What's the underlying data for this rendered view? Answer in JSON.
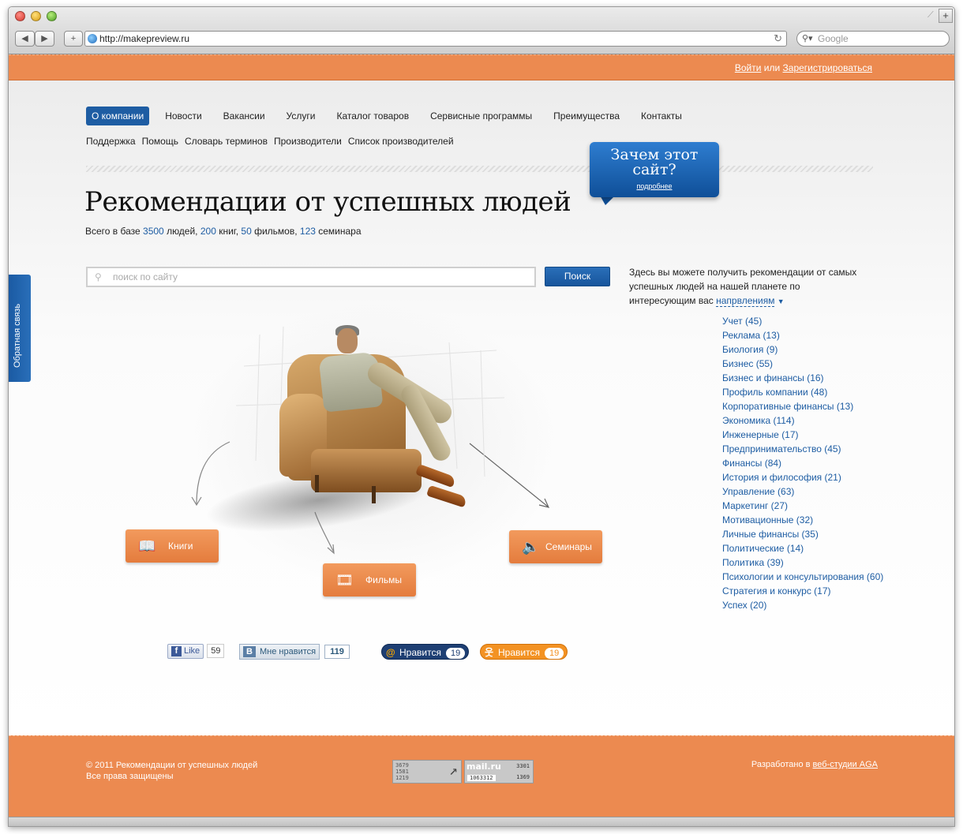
{
  "browser": {
    "url": "http://makepreview.ru",
    "search_placeholder": "Google",
    "back_icon": "◀",
    "forward_icon": "▶",
    "add_icon": "+",
    "reload_icon": "↻",
    "new_tab_icon": "+"
  },
  "auth": {
    "login": "Войти",
    "or": " или ",
    "register": "Зарегистрироваться"
  },
  "nav": {
    "primary": [
      "О компании",
      "Новости",
      "Вакансии",
      "Услуги",
      "Каталог товаров",
      "Сервисные программы",
      "Преимущества",
      "Контакты"
    ],
    "secondary": [
      "Поддержка",
      "Помощь",
      "Словарь терминов",
      "Производители",
      "Список производителей"
    ]
  },
  "promo": {
    "question": "Зачем этот сайт?",
    "more": "подробнее"
  },
  "heading": {
    "title": "Рекомендации от успешных людей",
    "stats_prefix": "Всего в базе ",
    "people_count": "3500",
    "people_label": " людей, ",
    "books_count": "200",
    "books_label": " книг, ",
    "films_count": "50",
    "films_label": " фильмов, ",
    "seminars_count": "123",
    "seminars_label": " семинара"
  },
  "search": {
    "placeholder": "поиск по сайту",
    "button": "Поиск"
  },
  "intro": {
    "text": "Здесь вы можете получить рекомендации от самых успешных людей на нашей планете по интересующим вас ",
    "directions": "напрвлениям",
    "caret": "▼"
  },
  "categories": [
    "Учет (45)",
    "Реклама (13)",
    "Биология (9)",
    "Бизнес (55)",
    "Бизнес и финансы (16)",
    "Профиль компании (48)",
    "Корпоративные финансы (13)",
    "Экономика (114)",
    "Инженерные (17)",
    "Предпринимательство (45)",
    "Финансы (84)",
    "История и философия (21)",
    "Управление (63)",
    "Маркетинг (27)",
    "Мотивационные (32)",
    "Личные финансы (35)",
    "Политические (14)",
    "Политика (39)",
    "Психологии и консультирования (60)",
    "Стратегия и конкурс (17)",
    "Успех (20)"
  ],
  "cta": {
    "books": "Книги",
    "films": "Фильмы",
    "seminars": "Семинары"
  },
  "social": {
    "fb_label": "Like",
    "fb_count": "59",
    "vk_label": "Мне нравится",
    "vk_count": "119",
    "mailru_label": "Нравится",
    "mailru_count": "19",
    "ok_label": "Нравится",
    "ok_count": "19"
  },
  "feedback": "Обратная связь",
  "footer": {
    "copyright": "© 2011 Рекомендации от успешных людей",
    "rights": "Все права защищены",
    "dev_prefix": "Разработано в ",
    "dev_link": "веб-студии AGA",
    "counter1": [
      "3679",
      "1581",
      "1219"
    ],
    "counter2_logo": "mail.ru",
    "counter2_a": "3301",
    "counter2_b": "1063312",
    "counter2_c": "1369"
  },
  "colors": {
    "orange": "#ec8a50",
    "blue": "#1e5da3"
  }
}
